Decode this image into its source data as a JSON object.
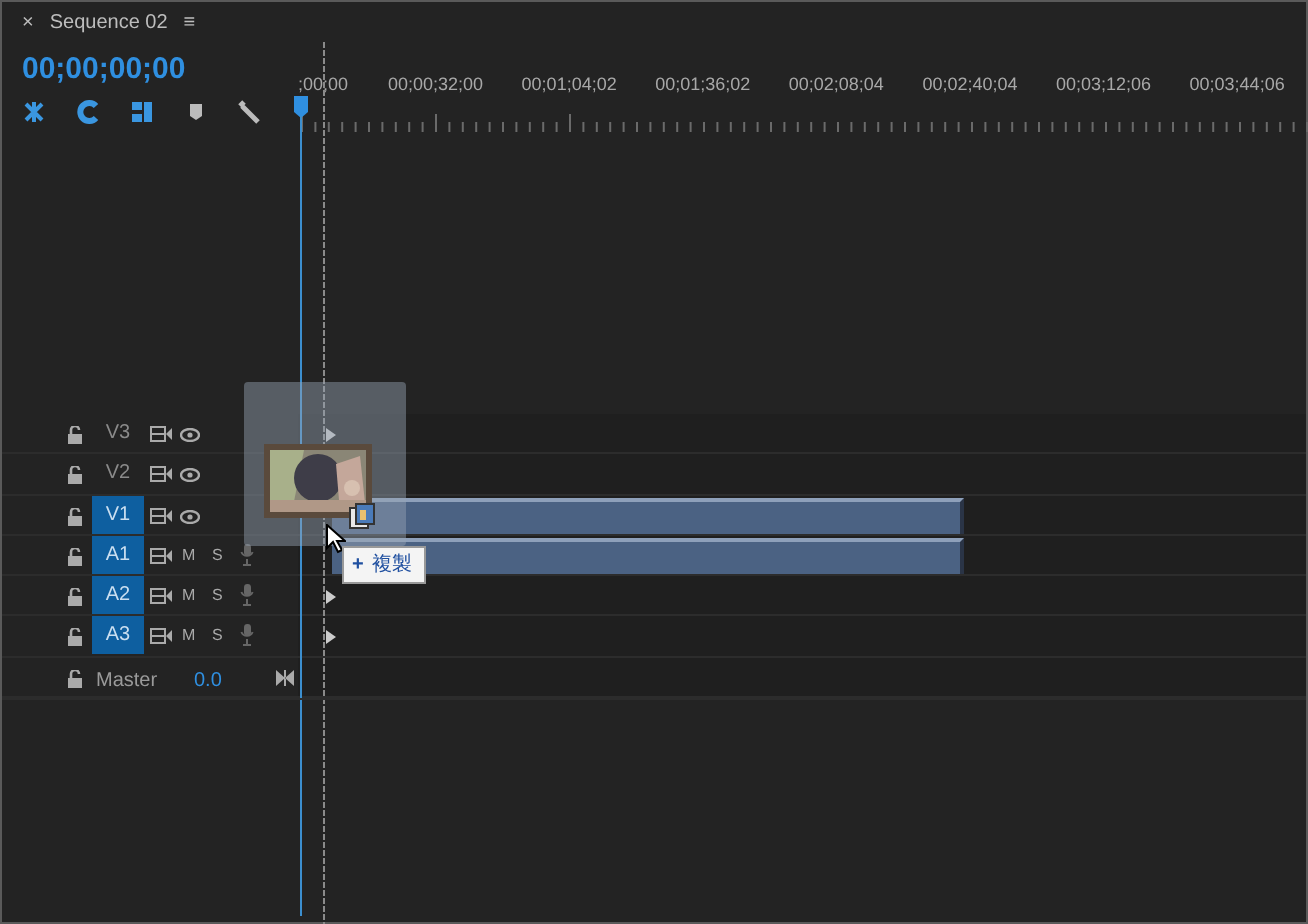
{
  "panel": {
    "close": "×",
    "title": "Sequence 02",
    "menu": "≡"
  },
  "timecode": "00;00;00;00",
  "ruler": {
    "labels": [
      ";00;00",
      "00;00;32;00",
      "00;01;04;02",
      "00;01;36;02",
      "00;02;08;04",
      "00;02;40;04",
      "00;03;12;06",
      "00;03;44;06"
    ]
  },
  "tracks": [
    {
      "kind": "video",
      "name": "V3",
      "targeted": false,
      "clip": false
    },
    {
      "kind": "video",
      "name": "V2",
      "targeted": false,
      "clip": false
    },
    {
      "kind": "video",
      "name": "V1",
      "targeted": true,
      "clip": true
    },
    {
      "kind": "audio",
      "name": "A1",
      "targeted": true,
      "clip": true,
      "mute": "M",
      "solo": "S"
    },
    {
      "kind": "audio",
      "name": "A2",
      "targeted": true,
      "clip": false,
      "mute": "M",
      "solo": "S"
    },
    {
      "kind": "audio",
      "name": "A3",
      "targeted": true,
      "clip": false,
      "mute": "M",
      "solo": "S"
    },
    {
      "kind": "master",
      "name": "Master",
      "value": "0.0"
    }
  ],
  "drag": {
    "kind": "picture",
    "tooltip": {
      "icon": "+",
      "label": "複製"
    }
  }
}
